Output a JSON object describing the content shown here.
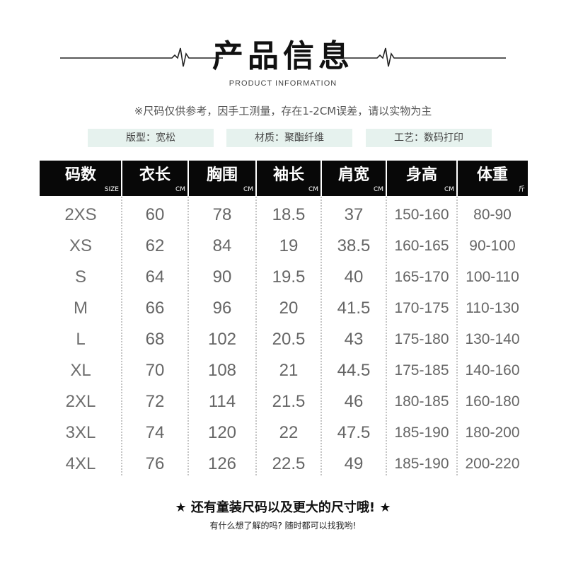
{
  "header": {
    "title": "产品信息",
    "subtitle": "PRODUCT INFORMATION"
  },
  "note": "※尺码仅供参考，因手工测量，存在1-2CM误差，请以实物为主",
  "info": {
    "style": "版型：宽松",
    "material": "材质：聚酯纤维",
    "craft": "工艺：数码打印"
  },
  "table": {
    "headers": [
      {
        "label": "码数",
        "unit": "SIZE"
      },
      {
        "label": "衣长",
        "unit": "CM"
      },
      {
        "label": "胸围",
        "unit": "CM"
      },
      {
        "label": "袖长",
        "unit": "CM"
      },
      {
        "label": "肩宽",
        "unit": "CM"
      },
      {
        "label": "身高",
        "unit": "CM"
      },
      {
        "label": "体重",
        "unit": "斤"
      }
    ],
    "rows": [
      [
        "2XS",
        "60",
        "78",
        "18.5",
        "37",
        "150-160",
        "80-90"
      ],
      [
        "XS",
        "62",
        "84",
        "19",
        "38.5",
        "160-165",
        "90-100"
      ],
      [
        "S",
        "64",
        "90",
        "19.5",
        "40",
        "165-170",
        "100-110"
      ],
      [
        "M",
        "66",
        "96",
        "20",
        "41.5",
        "170-175",
        "110-130"
      ],
      [
        "L",
        "68",
        "102",
        "20.5",
        "43",
        "175-180",
        "130-140"
      ],
      [
        "XL",
        "70",
        "108",
        "21",
        "44.5",
        "175-185",
        "140-160"
      ],
      [
        "2XL",
        "72",
        "114",
        "21.5",
        "46",
        "180-185",
        "160-180"
      ],
      [
        "3XL",
        "74",
        "120",
        "22",
        "47.5",
        "185-190",
        "180-200"
      ],
      [
        "4XL",
        "76",
        "126",
        "22.5",
        "49",
        "185-190",
        "200-220"
      ]
    ]
  },
  "footer": {
    "line1": "★ 还有童装尺码以及更大的尺寸哦! ★",
    "line2": "有什么想了解的吗? 随时都可以找我哟!"
  }
}
